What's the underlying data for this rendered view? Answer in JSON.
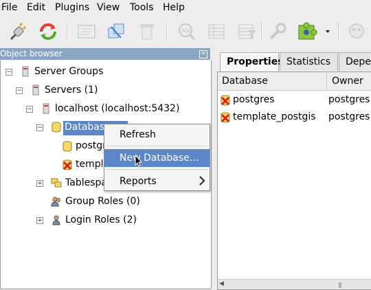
{
  "menubar": {
    "items": [
      "File",
      "Edit",
      "Plugins",
      "View",
      "Tools",
      "Help"
    ]
  },
  "toolbar": {
    "buttons": [
      {
        "icon": "connect-plug-icon",
        "enabled": true
      },
      {
        "icon": "refresh-icon",
        "enabled": true
      },
      {
        "icon": "properties-icon",
        "enabled": false
      },
      {
        "icon": "create-object-icon",
        "enabled": true
      },
      {
        "icon": "drop-object-icon",
        "enabled": false
      },
      {
        "icon": "sql-query-icon",
        "enabled": false
      },
      {
        "icon": "view-data-icon",
        "enabled": false
      },
      {
        "icon": "filtered-data-icon",
        "enabled": false
      },
      {
        "icon": "maintenance-icon",
        "enabled": false
      },
      {
        "icon": "plugins-icon",
        "enabled": true
      },
      {
        "icon": "help-icon",
        "enabled": false
      }
    ]
  },
  "browser": {
    "title": "Object browser",
    "tree": {
      "server_groups": "Server Groups",
      "servers": "Servers (1)",
      "localhost": "localhost (localhost:5432)",
      "databases": "Databases",
      "db_postgres": "postgres",
      "db_template": "template_postgis",
      "tablespaces": "Tablespaces",
      "group_roles": "Group Roles (0)",
      "login_roles": "Login Roles (2)"
    }
  },
  "right": {
    "tabs": [
      "Properties",
      "Statistics",
      "Dependencies"
    ],
    "active_tab": "Properties",
    "columns": [
      "Database",
      "Owner"
    ],
    "rows": [
      {
        "name": "postgres",
        "owner": "postgres"
      },
      {
        "name": "template_postgis",
        "owner": "postgres"
      }
    ],
    "scroll_grip": "|||"
  },
  "context_menu": {
    "items": [
      "Refresh",
      "New Database...",
      "Reports"
    ],
    "highlighted": "New Database..."
  },
  "colors": {
    "selection": "#5d87c7",
    "title_bar": "#8aa4c4"
  }
}
